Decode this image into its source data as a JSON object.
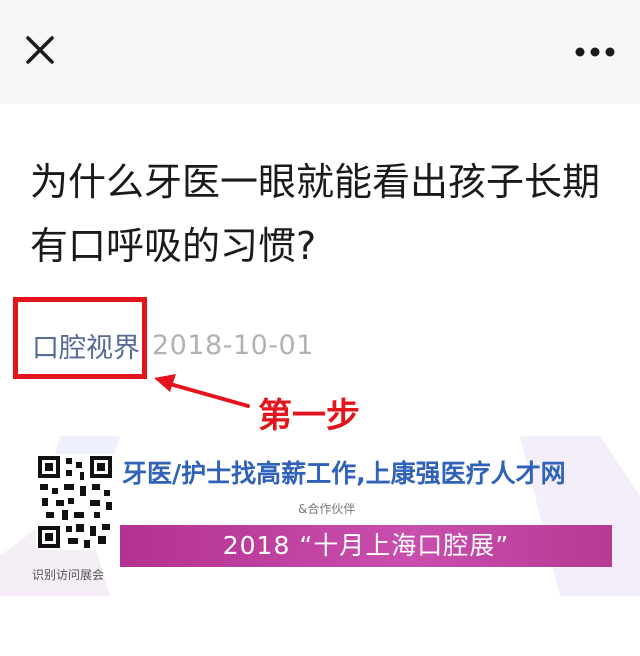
{
  "topbar": {
    "close_icon": "close-icon",
    "more_icon": "more-dots-icon"
  },
  "article": {
    "title": "为什么牙医一眼就能看出孩子长期有口呼吸的习惯?",
    "account_name": "口腔视界",
    "date": "2018-10-01"
  },
  "annotation": {
    "step_label": "第一步",
    "color": "#e3141b"
  },
  "banner": {
    "headline": "牙医/护士找高薪工作,上康强医疗人才网",
    "partner": "&合作伙伴",
    "expo": "2018 “十月上海口腔展”",
    "qr_caption": "识别访问展会"
  },
  "colors": {
    "link": "#576b95",
    "date": "#b2b2b2",
    "banner_blue": "#2f62b8",
    "banner_magenta": "#b3328f"
  }
}
